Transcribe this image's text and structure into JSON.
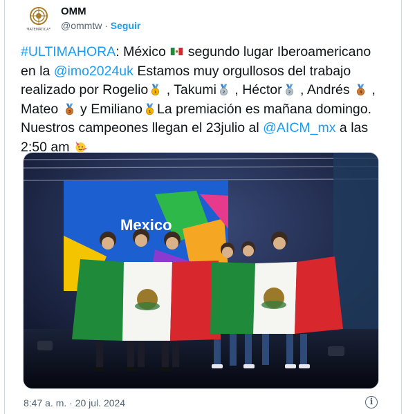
{
  "author": {
    "name": "OMM",
    "handle": "@ommtw",
    "separator": "·",
    "follow_label": "Seguir",
    "logo_caption": "MATEMÁTICAS"
  },
  "tweet": {
    "hashtag": "#ULTIMAHORA",
    "t1": ": México ",
    "t2": " segundo lugar Iberoamericano en la ",
    "mention1": "@imo2024uk",
    "t3": " Estamos muy orgullosos del trabajo realizado por Rogelio",
    "t4": " , Takumi",
    "t5": " , Héctor",
    "t6": " , Andrés ",
    "t7": " , Mateo ",
    "t8": " y Emiliano",
    "t9": "La premiación es mañana domingo. Nuestros campeones llegan el 23julio al ",
    "mention2": "@AICM_mx",
    "t10": " a las 2:50 am "
  },
  "media": {
    "stage_text": "Mexico",
    "alt": "Photo of the Mexican team holding two Mexican flags on stage"
  },
  "footer": {
    "timestamp": "8:47 a. m. · 20 jul. 2024",
    "info_glyph": "i"
  },
  "colors": {
    "link": "#1d9bf0",
    "text": "#0f1419",
    "secondary": "#536471",
    "flag_green": "#1f8a3a",
    "flag_red": "#d9272e",
    "medal_gold": "#f4b400",
    "medal_silver": "#b8c4cc",
    "medal_bronze": "#d07a34"
  }
}
